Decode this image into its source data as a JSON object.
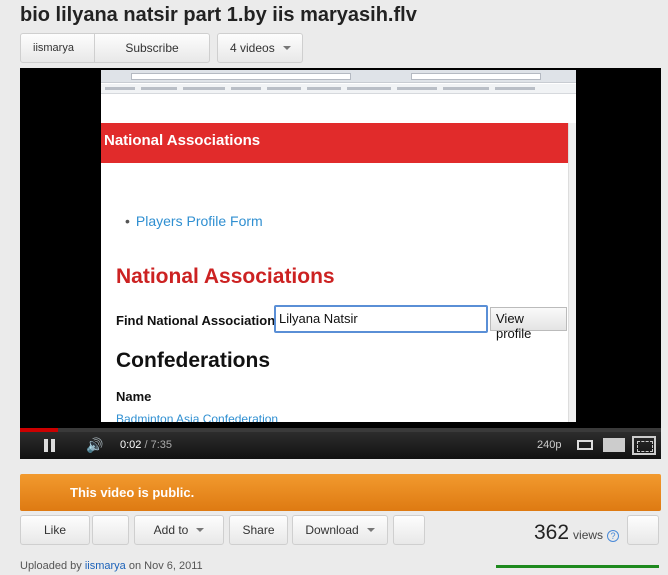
{
  "video": {
    "title": "bio lilyana natsir part 1.by iis maryasih.flv"
  },
  "channel": {
    "name": "iismarya",
    "subscribe_label": "Subscribe",
    "videos_label": "4 videos"
  },
  "player": {
    "screen": {
      "banner_title": "National Associations",
      "bullet_link": "Players Profile Form",
      "heading_associations": "National Associations",
      "find_label": "Find National Association:",
      "find_value": "Lilyana Natsir",
      "view_profile_label": "View profile",
      "heading_confederations": "Confederations",
      "name_label": "Name",
      "asia_link": "Badminton Asia Confederation"
    },
    "controls": {
      "current_time": "0:02",
      "separator": " / ",
      "duration": "7:35",
      "quality": "240p"
    },
    "progress_fraction": 0.0044,
    "colors": {
      "progress_played": "#cc0000",
      "banner": "#e12b2b"
    }
  },
  "notice": {
    "text": "This video is public.",
    "color": "#e8861f"
  },
  "actions": {
    "like_label": "Like",
    "add_to_label": "Add to",
    "share_label": "Share",
    "download_label": "Download",
    "views_count": "362",
    "views_label": "views",
    "help_glyph": "?"
  },
  "upload": {
    "prefix": "Uploaded by",
    "user": "iismarya",
    "on_label": "on",
    "date": "Nov 6, 2011"
  }
}
